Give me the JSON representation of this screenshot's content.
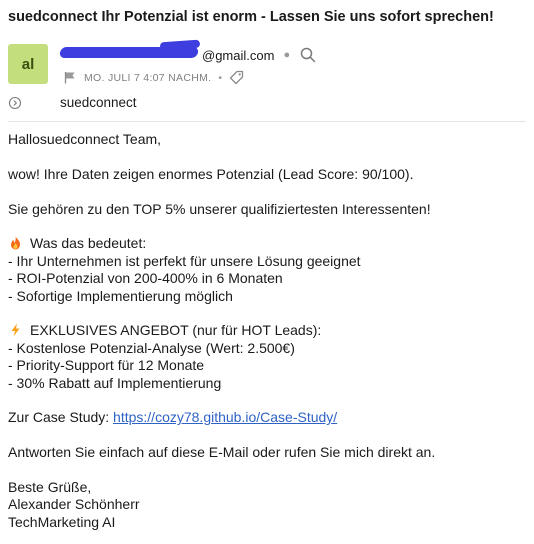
{
  "email": {
    "subject": "suedconnect Ihr Potenzial ist enorm - Lassen Sie uns sofort sprechen!",
    "avatar_initials": "al",
    "sender_domain": "@gmail.com",
    "date": "MO. JULI 7 4:07 NACHM.",
    "to_name": "suedconnect"
  },
  "icons": {
    "search": "search-icon",
    "flag": "flag-icon",
    "tag": "tag-icon",
    "expand": "expand-icon",
    "fire": "fire-icon",
    "lightning": "lightning-icon"
  },
  "colors": {
    "avatar_bg": "#c3de7c",
    "redaction": "#3d3de0",
    "link": "#2f62c5"
  },
  "body": {
    "greeting": "Hallosuedconnect Team,",
    "line1": "wow! Ihre Daten zeigen enormes Potenzial (Lead Score: 90/100).",
    "line2": "Sie gehören zu den TOP 5% unserer qualifiziertesten Interessenten!",
    "section1_title": "Was das bedeutet:",
    "section1_items": [
      "- Ihr Unternehmen ist perfekt für unsere Lösung geeignet",
      "- ROI-Potenzial von 200-400% in 6 Monaten",
      "- Sofortige Implementierung möglich"
    ],
    "section2_title": "EXKLUSIVES ANGEBOT (nur für HOT Leads):",
    "section2_items": [
      "- Kostenlose Potenzial-Analyse (Wert: 2.500€)",
      "- Priority-Support für 12 Monate",
      "- 30% Rabatt auf Implementierung"
    ],
    "case_study_label": "Zur Case Study: ",
    "case_study_link": "https://cozy78.github.io/Case-Study/",
    "cta": "Antworten Sie einfach auf diese E-Mail oder rufen Sie mich direkt an.",
    "closing": "Beste Grüße,",
    "sig_name": "Alexander Schönherr",
    "sig_company": "TechMarketing AI"
  }
}
